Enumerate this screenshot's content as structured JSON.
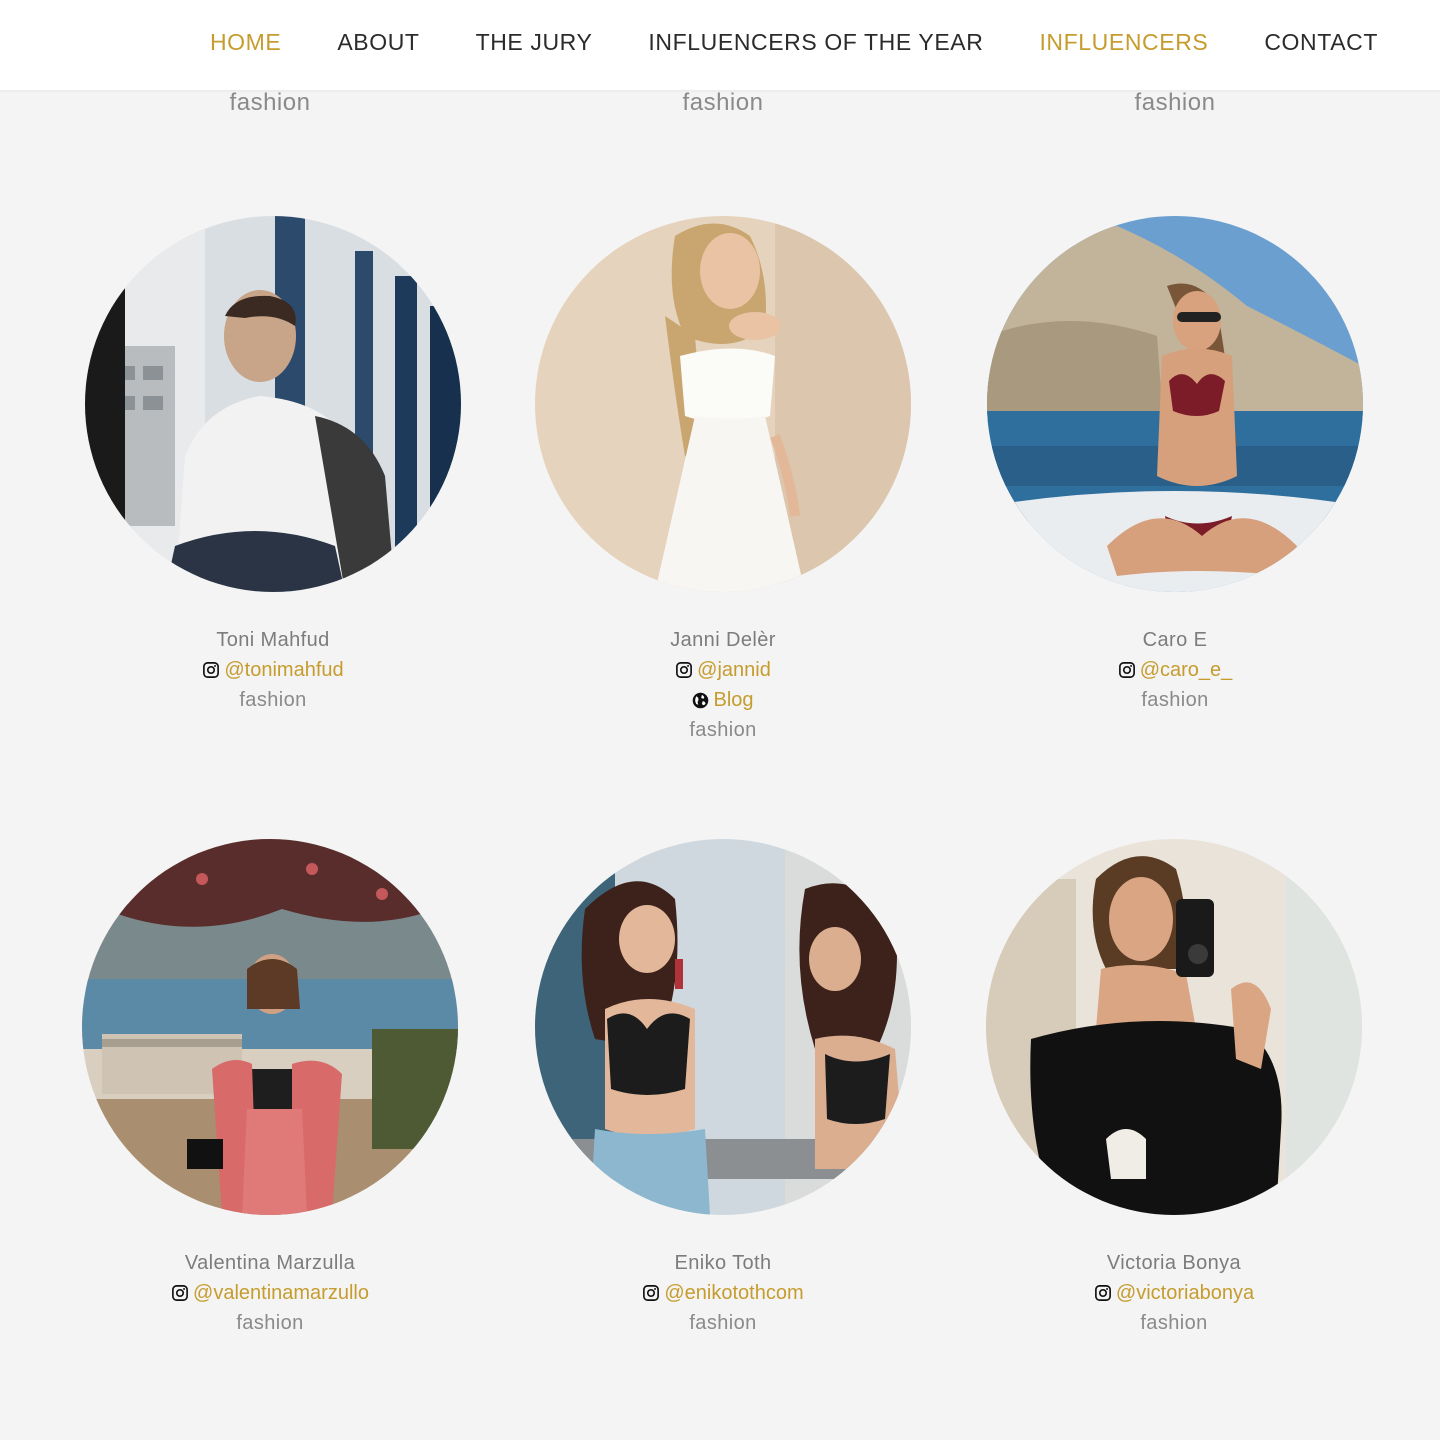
{
  "nav": {
    "items": [
      {
        "label": "HOME",
        "active": true
      },
      {
        "label": "ABOUT",
        "active": false
      },
      {
        "label": "THE JURY",
        "active": false
      },
      {
        "label": "INFLUENCERS OF THE YEAR",
        "active": false
      },
      {
        "label": "INFLUENCERS",
        "active": true
      },
      {
        "label": "CONTACT",
        "active": false
      }
    ]
  },
  "colors": {
    "accent": "#c69c2e",
    "text": "#2b2b2b",
    "muted": "#8a8a8a",
    "background": "#f4f4f4"
  },
  "top_row": {
    "categories": [
      "fashion",
      "fashion",
      "fashion"
    ]
  },
  "influencers": [
    {
      "name": "Toni Mahfud",
      "instagram": "@tonimahfud",
      "category": "fashion",
      "icon": "instagram-icon"
    },
    {
      "name": "Janni Delèr",
      "instagram": "@jannid",
      "blog": "Blog",
      "category": "fashion",
      "icon": "instagram-icon",
      "blog_icon": "globe-icon"
    },
    {
      "name": "Caro E",
      "instagram": "@caro_e_",
      "category": "fashion",
      "icon": "instagram-icon"
    },
    {
      "name": "Valentina Marzulla",
      "instagram": "@valentinamarzullo",
      "category": "fashion",
      "icon": "instagram-icon"
    },
    {
      "name": "Eniko Toth",
      "instagram": "@enikotothcom",
      "category": "fashion",
      "icon": "instagram-icon"
    },
    {
      "name": "Victoria Bonya",
      "instagram": "@victoriabonya",
      "category": "fashion",
      "icon": "instagram-icon"
    }
  ]
}
